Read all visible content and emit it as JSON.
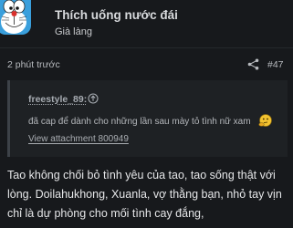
{
  "post": {
    "username": "Thích uống nước đái",
    "user_title": "Già làng",
    "time": "2 phút trước",
    "post_number": "#47",
    "share_icon": "share-icon",
    "avatar_icon": "doraemon-avatar"
  },
  "quote": {
    "author": "freestyle_89:",
    "author_icon": "arrow-up-circle-icon",
    "text": "đã cap để dành cho những lần sau mày tỏ tình nữ xam",
    "smiley_icon": "thinking-smiley-icon",
    "attachment_link": "View attachment 800949"
  },
  "message": {
    "text": "Tao không chối bỏ tình yêu của tao, tao sống thật với lòng. Doilahukhong, Xuanla, vợ thằng bạn, nhỏ tay vịn chỉ là dự phòng cho mối tình cay đắng,"
  },
  "colors": {
    "background": "#17191c",
    "quote_background": "#1e2124",
    "quote_border": "#3d4248"
  }
}
